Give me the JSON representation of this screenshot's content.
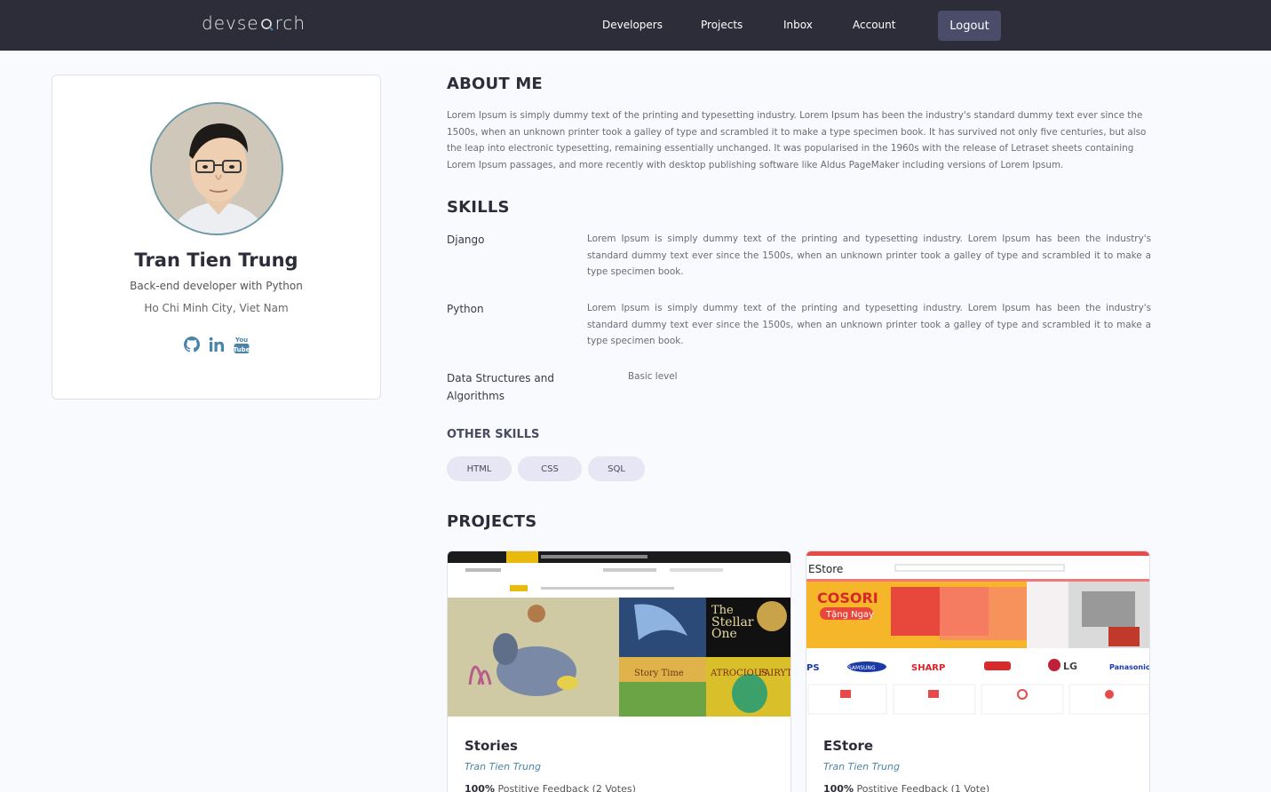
{
  "brand": {
    "logo_pre": "devse",
    "logo_post": "rch"
  },
  "nav": {
    "links": [
      "Developers",
      "Projects",
      "Inbox",
      "Account"
    ],
    "logout": "Logout"
  },
  "profile": {
    "name": "Tran Tien Trung",
    "headline": "Back-end developer with Python",
    "location": "Ho Chi Minh City, Viet Nam",
    "socials": [
      "github-icon",
      "linkedin-icon",
      "youtube-icon"
    ]
  },
  "about": {
    "title": "ABOUT ME",
    "text": "Lorem Ipsum is simply dummy text of the printing and typesetting industry. Lorem Ipsum has been the industry's standard dummy text ever since the 1500s, when an unknown printer took a galley of type and scrambled it to make a type specimen book. It has survived not only five centuries, but also the leap into electronic typesetting, remaining essentially unchanged. It was popularised in the 1960s with the release of Letraset sheets containing Lorem Ipsum passages, and more recently with desktop publishing software like Aldus PageMaker including versions of Lorem Ipsum."
  },
  "skills": {
    "title": "SKILLS",
    "items": [
      {
        "name": "Django",
        "description": "Lorem Ipsum is simply dummy text of the printing and typesetting industry. Lorem Ipsum has been the industry's standard dummy text ever since the 1500s, when an unknown printer took a galley of type and scrambled it to make a type specimen book."
      },
      {
        "name": "Python",
        "description": "Lorem Ipsum is simply dummy text of the printing and typesetting industry. Lorem Ipsum has been the industry's standard dummy text ever since the 1500s, when an unknown printer took a galley of type and scrambled it to make a type specimen book."
      },
      {
        "name": "Data Structures and Algorithms",
        "description": "Basic level"
      }
    ]
  },
  "other_skills": {
    "title": "OTHER SKILLS",
    "tags": [
      "HTML",
      "CSS",
      "SQL"
    ]
  },
  "projects": {
    "title": "PROJECTS",
    "items": [
      {
        "title": "Stories",
        "author": "Tran Tien Trung",
        "feedback_pct": "100%",
        "feedback_text": "Postitive Feedback (2 Votes)"
      },
      {
        "title": "EStore",
        "author": "Tran Tien Trung",
        "feedback_pct": "100%",
        "feedback_text": "Postitive Feedback (1 Vote)"
      }
    ]
  },
  "colors": {
    "navbar": "#2d2d39",
    "accent": "#4a84a9",
    "tag_bg": "#e6e6f4",
    "logout_bg": "#4b4c6a"
  }
}
